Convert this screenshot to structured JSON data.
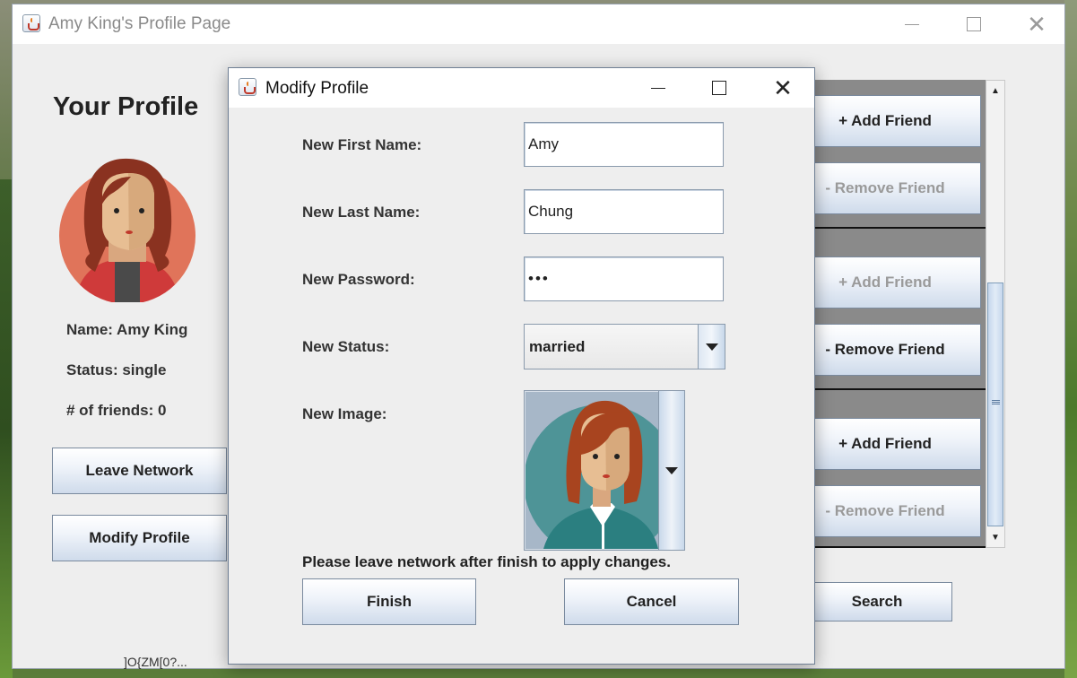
{
  "main_window": {
    "title": "Amy King's Profile Page",
    "heading": "Your Profile",
    "profile": {
      "name_text": "Name: Amy King",
      "status_text": "Status: single",
      "friends_text": "# of friends: 0"
    },
    "buttons": {
      "leave_network": "Leave Network",
      "modify_profile": "Modify Profile",
      "search": "Search"
    },
    "friend_rows": [
      {
        "add_label": "+ Add Friend",
        "add_enabled": true,
        "remove_label": "- Remove Friend",
        "remove_enabled": false
      },
      {
        "add_label": "+ Add Friend",
        "add_enabled": false,
        "remove_label": "- Remove Friend",
        "remove_enabled": true
      },
      {
        "add_label": "+ Add Friend",
        "add_enabled": true,
        "remove_label": "- Remove Friend",
        "remove_enabled": false
      }
    ],
    "partial_bottom_text": "]O{ZM[0?..."
  },
  "dialog": {
    "title": "Modify Profile",
    "labels": {
      "first_name": "New First Name:",
      "last_name": "New Last Name:",
      "password": "New Password:",
      "status": "New Status:",
      "image": "New Image:"
    },
    "values": {
      "first_name": "Amy",
      "last_name": "Chung",
      "password": "•••",
      "status": "married"
    },
    "note": "Please leave network after finish to apply changes.",
    "buttons": {
      "finish": "Finish",
      "cancel": "Cancel"
    }
  },
  "icons": {
    "window_icon": "java-icon",
    "minimize": "minimize-icon",
    "maximize": "maximize-icon",
    "close": "close-icon",
    "dropdown": "chevron-down-icon"
  }
}
